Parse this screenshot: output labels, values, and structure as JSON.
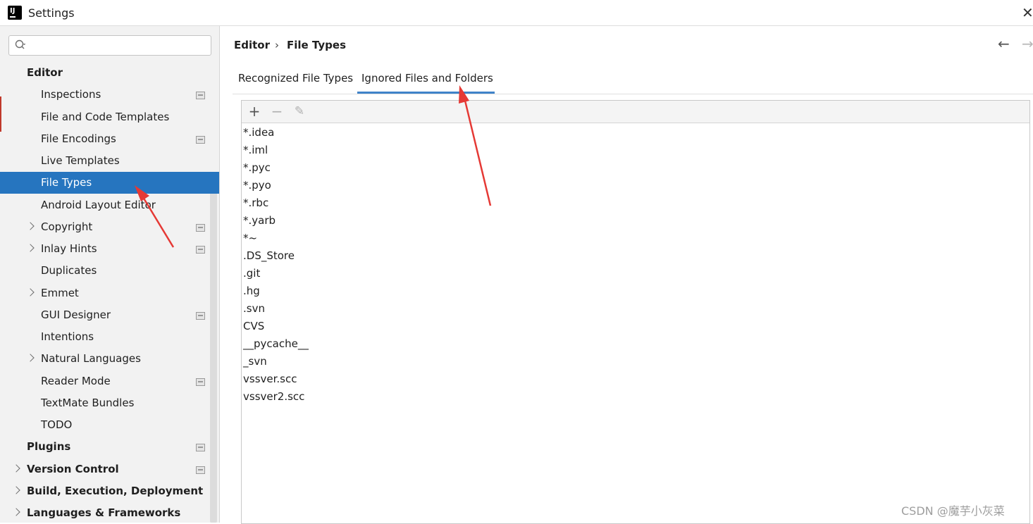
{
  "window": {
    "title": "Settings",
    "close_glyph": "✕"
  },
  "sidebar": {
    "search": {
      "placeholder": ""
    },
    "items": [
      {
        "label": "Editor",
        "level": 0,
        "bold": true,
        "expandable": false,
        "project": false,
        "selected": false
      },
      {
        "label": "Inspections",
        "level": 1,
        "bold": false,
        "expandable": false,
        "project": true,
        "selected": false
      },
      {
        "label": "File and Code Templates",
        "level": 1,
        "bold": false,
        "expandable": false,
        "project": false,
        "selected": false
      },
      {
        "label": "File Encodings",
        "level": 1,
        "bold": false,
        "expandable": false,
        "project": true,
        "selected": false
      },
      {
        "label": "Live Templates",
        "level": 1,
        "bold": false,
        "expandable": false,
        "project": false,
        "selected": false
      },
      {
        "label": "File Types",
        "level": 1,
        "bold": false,
        "expandable": false,
        "project": false,
        "selected": true
      },
      {
        "label": "Android Layout Editor",
        "level": 1,
        "bold": false,
        "expandable": false,
        "project": false,
        "selected": false
      },
      {
        "label": "Copyright",
        "level": 1,
        "bold": false,
        "expandable": true,
        "project": true,
        "selected": false
      },
      {
        "label": "Inlay Hints",
        "level": 1,
        "bold": false,
        "expandable": true,
        "project": true,
        "selected": false
      },
      {
        "label": "Duplicates",
        "level": 1,
        "bold": false,
        "expandable": false,
        "project": false,
        "selected": false
      },
      {
        "label": "Emmet",
        "level": 1,
        "bold": false,
        "expandable": true,
        "project": false,
        "selected": false
      },
      {
        "label": "GUI Designer",
        "level": 1,
        "bold": false,
        "expandable": false,
        "project": true,
        "selected": false
      },
      {
        "label": "Intentions",
        "level": 1,
        "bold": false,
        "expandable": false,
        "project": false,
        "selected": false
      },
      {
        "label": "Natural Languages",
        "level": 1,
        "bold": false,
        "expandable": true,
        "project": false,
        "selected": false
      },
      {
        "label": "Reader Mode",
        "level": 1,
        "bold": false,
        "expandable": false,
        "project": true,
        "selected": false
      },
      {
        "label": "TextMate Bundles",
        "level": 1,
        "bold": false,
        "expandable": false,
        "project": false,
        "selected": false
      },
      {
        "label": "TODO",
        "level": 1,
        "bold": false,
        "expandable": false,
        "project": false,
        "selected": false
      },
      {
        "label": "Plugins",
        "level": 0,
        "bold": true,
        "expandable": false,
        "project": true,
        "selected": false
      },
      {
        "label": "Version Control",
        "level": 0,
        "bold": true,
        "expandable": true,
        "project": true,
        "selected": false
      },
      {
        "label": "Build, Execution, Deployment",
        "level": 0,
        "bold": true,
        "expandable": true,
        "project": false,
        "selected": false
      },
      {
        "label": "Languages & Frameworks",
        "level": 0,
        "bold": true,
        "expandable": true,
        "project": false,
        "selected": false
      }
    ]
  },
  "breadcrumb": {
    "parent": "Editor",
    "separator": "›",
    "current": "File Types"
  },
  "nav": {
    "back": "←",
    "forward": "→"
  },
  "tabs": [
    {
      "label": "Recognized File Types",
      "active": false
    },
    {
      "label": "Ignored Files and Folders",
      "active": true
    }
  ],
  "toolbar": {
    "add": "+",
    "remove": "−",
    "edit": "✎"
  },
  "ignored": [
    "*.idea",
    "*.iml",
    "*.pyc",
    "*.pyo",
    "*.rbc",
    "*.yarb",
    "*~",
    ".DS_Store",
    ".git",
    ".hg",
    ".svn",
    "CVS",
    "__pycache__",
    "_svn",
    "vssver.scc",
    "vssver2.scc"
  ],
  "watermark": "CSDN @魔芋小灰菜",
  "colors": {
    "selection": "#2675bf",
    "tab_underline": "#4083c9",
    "annotation_arrow": "#e53935"
  }
}
